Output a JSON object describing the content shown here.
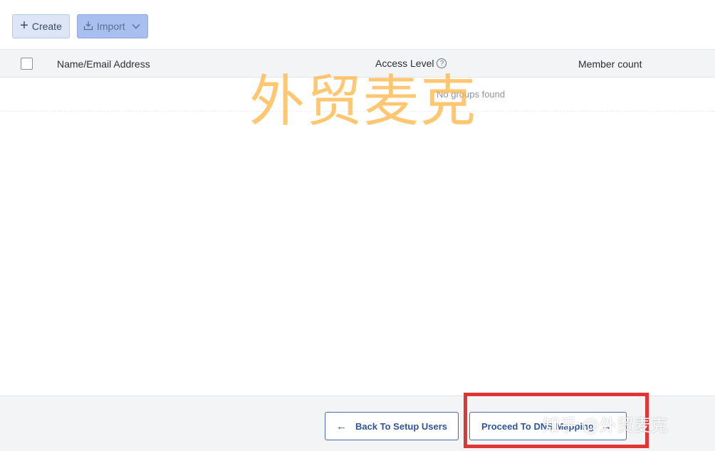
{
  "toolbar": {
    "create_label": "Create",
    "import_label": "Import"
  },
  "table": {
    "headers": {
      "name": "Name/Email Address",
      "access": "Access Level",
      "members": "Member count"
    },
    "empty_text": "No groups found"
  },
  "footer": {
    "back_label": "Back To Setup Users",
    "proceed_label": "Proceed To DNS Mapping"
  },
  "overlays": {
    "watermark": "外贸麦克",
    "zhihu_watermark": "知乎 @外贸麦克"
  },
  "colors": {
    "primary": "#2f5597",
    "highlight": "#e03535",
    "watermark": "#ffb23c"
  }
}
